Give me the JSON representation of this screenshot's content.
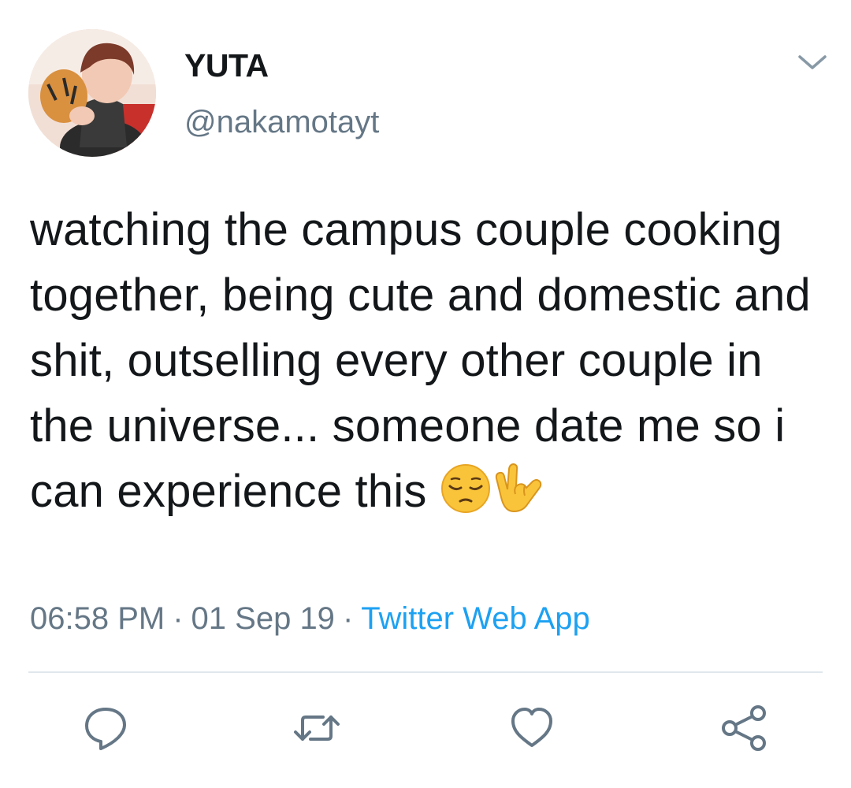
{
  "user": {
    "display_name": "YUTA",
    "handle": "@nakamotayt",
    "avatar_icon": "profile-photo"
  },
  "tweet": {
    "text": "watching the campus couple cooking together, being cute and domestic and shit, outselling every other couple in the universe... someone date me so i can experience this",
    "emojis": [
      "pensive-face-emoji",
      "love-you-gesture-emoji"
    ],
    "time": "06:58 PM",
    "separator": "·",
    "date": "01 Sep 19",
    "source": "Twitter Web App"
  },
  "menu": {
    "icon": "chevron-down-icon"
  },
  "actions": [
    {
      "icon": "reply-icon"
    },
    {
      "icon": "retweet-icon"
    },
    {
      "icon": "like-icon"
    },
    {
      "icon": "share-icon"
    }
  ],
  "colors": {
    "text": "#14171a",
    "secondary": "#657786",
    "link": "#1da1f2",
    "divider": "#e1e8ed"
  }
}
